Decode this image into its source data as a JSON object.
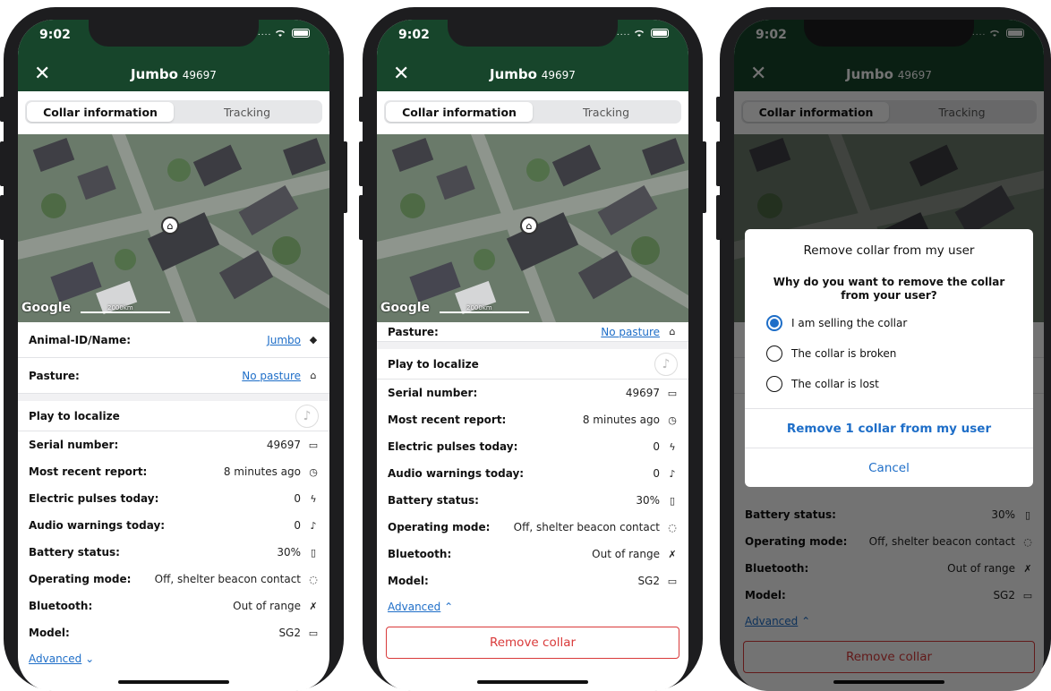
{
  "status": {
    "time": "9:02",
    "signal": "....."
  },
  "header": {
    "close": "✕",
    "name": "Jumbo",
    "serial": "49697"
  },
  "tabs": [
    {
      "label": "Collar information"
    },
    {
      "label": "Tracking"
    }
  ],
  "map": {
    "google": "Google",
    "scale": "2000km"
  },
  "fields": {
    "animal": {
      "label": "Animal-ID/Name:",
      "value": "Jumbo"
    },
    "pasture": {
      "label": "Pasture:",
      "value": "No pasture"
    },
    "play": {
      "label": "Play to localize"
    },
    "serial": {
      "label": "Serial number:",
      "value": "49697"
    },
    "report": {
      "label": "Most recent report:",
      "value": "8 minutes ago"
    },
    "pulses": {
      "label": "Electric pulses today:",
      "value": "0"
    },
    "audio": {
      "label": "Audio warnings today:",
      "value": "0"
    },
    "battery": {
      "label": "Battery status:",
      "value": "30%"
    },
    "mode": {
      "label": "Operating mode:",
      "value": "Off, shelter beacon contact"
    },
    "bluetooth": {
      "label": "Bluetooth:",
      "value": "Out of range"
    },
    "model": {
      "label": "Model:",
      "value": "SG2"
    }
  },
  "advanced": {
    "label": "Advanced",
    "chev_down": "⌄",
    "chev_up": "⌃"
  },
  "remove": {
    "label": "Remove collar"
  },
  "dialog": {
    "title": "Remove collar from my user",
    "question": "Why do you want to remove the collar from your user?",
    "options": [
      {
        "label": "I am selling the collar",
        "selected": true
      },
      {
        "label": "The collar is broken",
        "selected": false
      },
      {
        "label": "The collar is lost",
        "selected": false
      }
    ],
    "confirm": "Remove 1 collar from my user",
    "cancel": "Cancel"
  },
  "icons": {
    "tag": "tag-icon",
    "home": "home-icon",
    "music": "music-note-icon",
    "device": "device-icon",
    "clock": "clock-icon",
    "bolt": "lightning-icon",
    "note": "note-icon",
    "battery": "battery-icon",
    "dashed": "dashed-circle-icon",
    "bt": "bluetooth-off-icon"
  },
  "colors": {
    "header": "#17452b",
    "link": "#1e6ec8",
    "danger": "#d93a3a"
  }
}
